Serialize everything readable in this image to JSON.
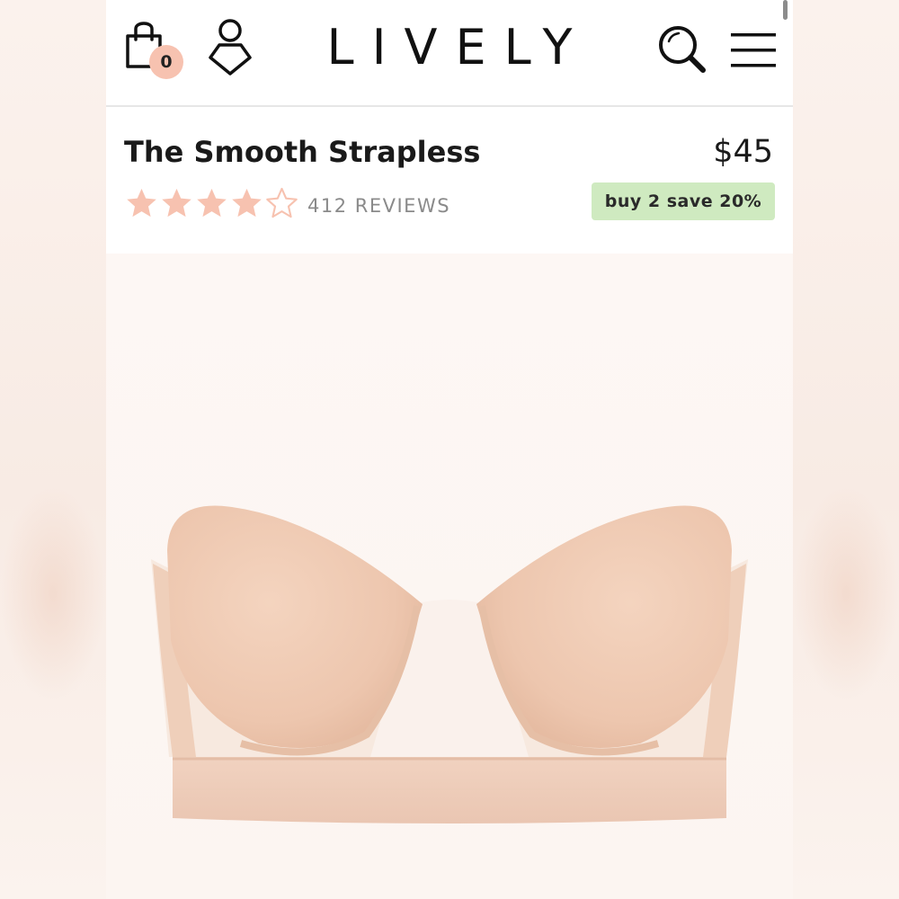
{
  "header": {
    "logo": "LIVELY",
    "cart_count": "0",
    "icons": {
      "cart": "shopping-bag-icon",
      "account": "account-icon",
      "search": "search-icon",
      "menu": "hamburger-menu-icon"
    }
  },
  "product": {
    "title": "The Smooth Strapless",
    "price": "$45",
    "rating": 4,
    "rating_max": 5,
    "reviews_label": "412 REVIEWS",
    "promo_label": "buy 2 save 20%",
    "image": "product-bra-image"
  },
  "colors": {
    "star": "#f7c2b0",
    "promo_bg": "#cfeac0",
    "badge_bg": "#f7c2b0"
  }
}
